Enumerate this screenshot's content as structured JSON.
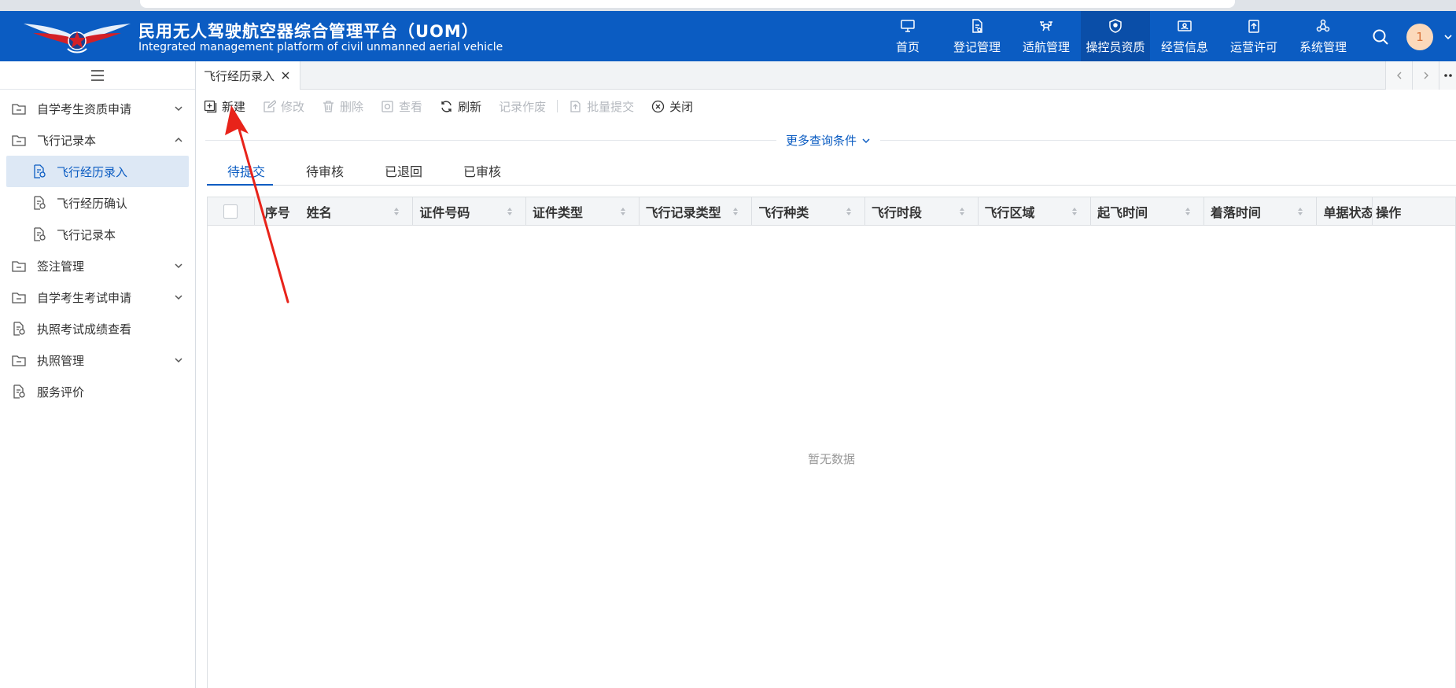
{
  "brand": {
    "title": "民用无人驾驶航空器综合管理平台（UOM）",
    "subtitle": "Integrated management platform of civil unmanned aerial vehicle"
  },
  "nav": [
    {
      "label": "首页",
      "icon": "monitor-icon"
    },
    {
      "label": "登记管理",
      "icon": "document-edit-icon"
    },
    {
      "label": "适航管理",
      "icon": "drone-icon"
    },
    {
      "label": "操控员资质",
      "icon": "shield-icon",
      "active": true
    },
    {
      "label": "经营信息",
      "icon": "id-card-icon"
    },
    {
      "label": "运营许可",
      "icon": "upload-clipboard-icon"
    },
    {
      "label": "系统管理",
      "icon": "cluster-icon"
    }
  ],
  "user": {
    "avatar_text": "1"
  },
  "sidebar": {
    "items": [
      {
        "label": "自学考生资质申请",
        "icon": "folder-icon",
        "expandable": true,
        "expanded": false
      },
      {
        "label": "飞行记录本",
        "icon": "folder-open-icon",
        "expandable": true,
        "expanded": true
      },
      {
        "label": "飞行经历录入",
        "icon": "file-gear-icon",
        "sub": true,
        "active": true
      },
      {
        "label": "飞行经历确认",
        "icon": "file-gear-icon",
        "sub": true
      },
      {
        "label": "飞行记录本",
        "icon": "file-gear-icon",
        "sub": true
      },
      {
        "label": "签注管理",
        "icon": "folder-icon",
        "expandable": true,
        "expanded": false
      },
      {
        "label": "自学考生考试申请",
        "icon": "folder-icon",
        "expandable": true,
        "expanded": false
      },
      {
        "label": "执照考试成绩查看",
        "icon": "file-gear-icon"
      },
      {
        "label": "执照管理",
        "icon": "folder-icon",
        "expandable": true,
        "expanded": false
      },
      {
        "label": "服务评价",
        "icon": "file-gear-icon"
      }
    ]
  },
  "tab": {
    "label": "飞行经历录入"
  },
  "toolbar": {
    "new": "新建",
    "edit": "修改",
    "delete": "删除",
    "view": "查看",
    "refresh": "刷新",
    "void": "记录作废",
    "batch_submit": "批量提交",
    "close": "关闭"
  },
  "more_query": "更多查询条件",
  "subtabs": [
    "待提交",
    "待审核",
    "已退回",
    "已审核"
  ],
  "table": {
    "columns": [
      "序号",
      "姓名",
      "证件号码",
      "证件类型",
      "飞行记录类型",
      "飞行种类",
      "飞行时段",
      "飞行区域",
      "起飞时间",
      "着落时间",
      "单据状态",
      "操作"
    ],
    "rows": [],
    "empty_text": "暂无数据"
  },
  "colors": {
    "primary": "#0b5cc2",
    "nav_active": "#0a4ea8",
    "annotation": "#e8231a"
  }
}
